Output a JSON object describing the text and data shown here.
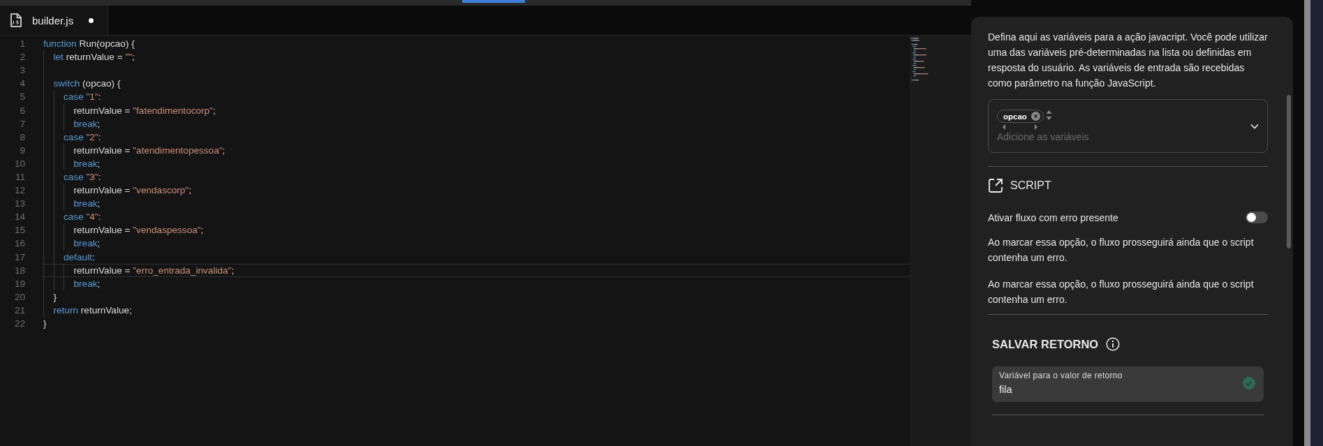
{
  "tab": {
    "label": "builder.js",
    "selected": true,
    "modified": true
  },
  "code": [
    {
      "number": "1",
      "current": false,
      "tokens": [
        {
          "kind": "keyword",
          "text": "function"
        },
        {
          "kind": "plain",
          "text": " Run(opcao) {"
        }
      ],
      "children": [
        {
          "number": "2",
          "current": false,
          "tokens": [
            {
              "kind": "keyword",
              "text": "let"
            },
            {
              "kind": "plain",
              "text": " returnValue = "
            },
            {
              "kind": "string",
              "text": "\"\""
            },
            {
              "kind": "plain",
              "text": ";"
            }
          ]
        },
        {
          "number": "3",
          "current": false
        },
        {
          "number": "4",
          "current": false,
          "tokens": [
            {
              "kind": "keyword",
              "text": "switch"
            },
            {
              "kind": "plain",
              "text": " (opcao) {"
            }
          ],
          "children": [
            {
              "number": "5",
              "current": false,
              "tokens": [
                {
                  "kind": "keyword",
                  "text": "case "
                },
                {
                  "kind": "string",
                  "text": "\"1\""
                },
                {
                  "kind": "plain",
                  "text": ":"
                }
              ],
              "children": [
                {
                  "number": "6",
                  "current": false,
                  "tokens": [
                    {
                      "kind": "plain",
                      "text": "returnValue = "
                    },
                    {
                      "kind": "string",
                      "text": "\"fatendimentocorp\""
                    },
                    {
                      "kind": "plain",
                      "text": ";"
                    }
                  ]
                },
                {
                  "number": "7",
                  "current": false,
                  "tokens": [
                    {
                      "kind": "keyword",
                      "text": "break"
                    },
                    {
                      "kind": "plain",
                      "text": ";"
                    }
                  ]
                }
              ]
            },
            {
              "number": "8",
              "current": false,
              "tokens": [
                {
                  "kind": "keyword",
                  "text": "case "
                },
                {
                  "kind": "string",
                  "text": "\"2\""
                },
                {
                  "kind": "plain",
                  "text": ":"
                }
              ],
              "children": [
                {
                  "number": "9",
                  "current": false,
                  "tokens": [
                    {
                      "kind": "plain",
                      "text": "returnValue = "
                    },
                    {
                      "kind": "string",
                      "text": "\"atendimentopessoa\""
                    },
                    {
                      "kind": "plain",
                      "text": ";"
                    }
                  ]
                },
                {
                  "number": "10",
                  "current": false,
                  "tokens": [
                    {
                      "kind": "keyword",
                      "text": "break"
                    },
                    {
                      "kind": "plain",
                      "text": ";"
                    }
                  ]
                }
              ]
            },
            {
              "number": "11",
              "current": false,
              "tokens": [
                {
                  "kind": "keyword",
                  "text": "case "
                },
                {
                  "kind": "string",
                  "text": "\"3\""
                },
                {
                  "kind": "plain",
                  "text": ":"
                }
              ],
              "children": [
                {
                  "number": "12",
                  "current": false,
                  "tokens": [
                    {
                      "kind": "plain",
                      "text": "returnValue = "
                    },
                    {
                      "kind": "string",
                      "text": "\"vendascorp\""
                    },
                    {
                      "kind": "plain",
                      "text": ";"
                    }
                  ]
                },
                {
                  "number": "13",
                  "current": false,
                  "tokens": [
                    {
                      "kind": "keyword",
                      "text": "break"
                    },
                    {
                      "kind": "plain",
                      "text": ";"
                    }
                  ]
                }
              ]
            },
            {
              "number": "14",
              "current": false,
              "tokens": [
                {
                  "kind": "keyword",
                  "text": "case "
                },
                {
                  "kind": "string",
                  "text": "\"4\""
                },
                {
                  "kind": "plain",
                  "text": ":"
                }
              ],
              "children": [
                {
                  "number": "15",
                  "current": false,
                  "tokens": [
                    {
                      "kind": "plain",
                      "text": "returnValue = "
                    },
                    {
                      "kind": "string",
                      "text": "\"vendaspessoa\""
                    },
                    {
                      "kind": "plain",
                      "text": ";"
                    }
                  ]
                },
                {
                  "number": "16",
                  "current": false,
                  "tokens": [
                    {
                      "kind": "keyword",
                      "text": "break"
                    },
                    {
                      "kind": "plain",
                      "text": ";"
                    }
                  ]
                }
              ]
            },
            {
              "number": "17",
              "current": false,
              "tokens": [
                {
                  "kind": "keyword",
                  "text": "default"
                },
                {
                  "kind": "plain",
                  "text": ":"
                }
              ],
              "children": [
                {
                  "number": "18",
                  "current": true,
                  "tokens": [
                    {
                      "kind": "plain",
                      "text": "returnValue = "
                    },
                    {
                      "kind": "string",
                      "text": "\"erro_entrada_invalida\""
                    },
                    {
                      "kind": "plain",
                      "text": ";"
                    }
                  ]
                },
                {
                  "number": "19",
                  "current": false,
                  "tokens": [
                    {
                      "kind": "keyword",
                      "text": "break"
                    },
                    {
                      "kind": "plain",
                      "text": ";"
                    }
                  ]
                }
              ]
            }
          ]
        },
        {
          "number": "20",
          "current": false,
          "tokens": [
            {
              "kind": "plain",
              "text": "}"
            }
          ]
        },
        {
          "number": "21",
          "current": false,
          "tokens": [
            {
              "kind": "keyword",
              "text": "return"
            },
            {
              "kind": "plain",
              "text": " returnValue;"
            }
          ]
        }
      ]
    },
    {
      "number": "22",
      "current": false,
      "tokens": [
        {
          "kind": "plain",
          "text": "}"
        }
      ]
    }
  ],
  "panel": {
    "description": "Defina aqui as variáveis para a ação javacript. Você pode utilizar uma das variáveis pré-determinadas na lista ou definidas em resposta do usuário. As variáveis de entrada são recebidas como parâmetro na função JavaScript.",
    "variables_field": {
      "chips": [
        "opcao"
      ],
      "placeholder": "Adicione as variáveis"
    },
    "script_heading": "SCRIPT",
    "toggle": {
      "label": "Ativar fluxo com erro presente",
      "on": false
    },
    "notes": [
      "Ao marcar essa opção, o fluxo prosseguirá ainda que o script contenha um erro.",
      "Ao marcar essa opção, o fluxo prosseguirá ainda que o script contenha um erro."
    ],
    "return_heading": "SALVAR RETORNO",
    "return_field": {
      "label": "Variável para o valor de retorno",
      "value": "fila",
      "valid": true
    }
  }
}
